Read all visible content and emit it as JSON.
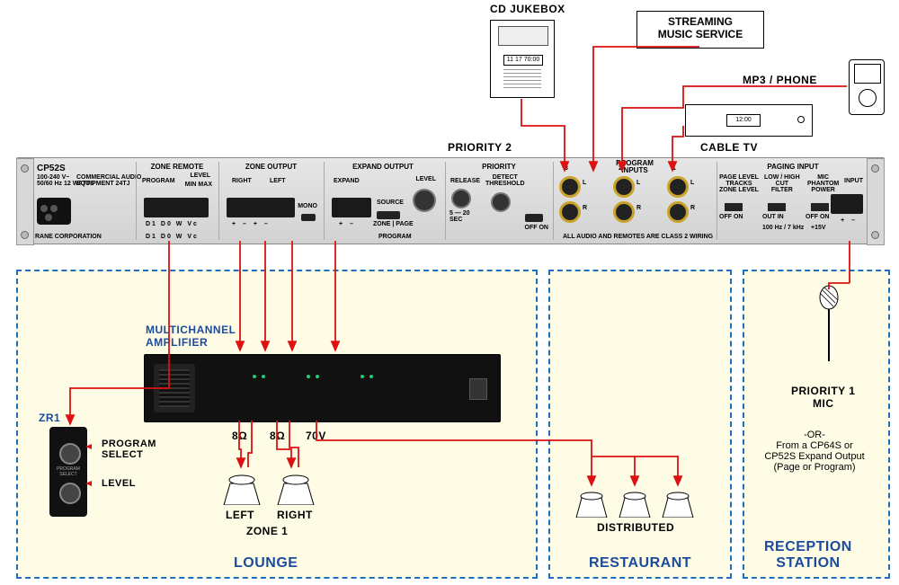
{
  "sources": {
    "cd_jukebox": "CD JUKEBOX",
    "streaming": "STREAMING\nMUSIC SERVICE",
    "mp3": "MP3 / PHONE",
    "cabletv": "CABLE TV",
    "jukebox_display": "11 17 70:00",
    "cabletv_time": "12:00"
  },
  "priorities": {
    "p1": "PRIORITY 1\nMIC",
    "p2": "PRIORITY 2"
  },
  "rack": {
    "model": "CP52S",
    "power_spec": "100-240 V~\n50/60 Hz 12 WATTS",
    "brand": "RANE CORPORATION",
    "ul": "COMMERCIAL AUDIO\nEQUIPMENT 24TJ",
    "sections": {
      "zone_remote": {
        "title": "ZONE REMOTE",
        "program": "PROGRAM",
        "level": "LEVEL",
        "pins": "D1  D0    W  Vc",
        "pins2": "MIN   MAX"
      },
      "zone_output": {
        "title": "ZONE OUTPUT",
        "right": "RIGHT",
        "left": "LEFT",
        "mono": "MONO",
        "pins": "+  –   +  –"
      },
      "expand_output": {
        "title": "EXPAND OUTPUT",
        "expand": "EXPAND",
        "source": "SOURCE",
        "switch": "ZONE | PAGE",
        "program": "PROGRAM",
        "level": "LEVEL",
        "pins": "+  –"
      },
      "priority": {
        "title": "PRIORITY",
        "release": "RELEASE",
        "release_scale": "5 — 20\nSEC",
        "detect": "DETECT\nTHRESHOLD",
        "offon": "OFF   ON"
      },
      "program_inputs": {
        "title": "PROGRAM\nINPUTS",
        "ch": [
          "3",
          "2",
          "1"
        ],
        "lr": [
          "L",
          "R"
        ]
      },
      "paging_input": {
        "title": "PAGING INPUT",
        "page_level": "PAGE LEVEL\nTRACKS\nZONE LEVEL",
        "filter": "LOW / HIGH\nCUT\nFILTER",
        "filter_vals": "100 Hz / 7 kHz",
        "phantom": "MIC\nPHANTOM\nPOWER",
        "phantom_val": "+15V",
        "input": "INPUT",
        "offon": "OFF       ON",
        "outin": "OUT       IN",
        "pins": "+  –"
      }
    },
    "class2": "ALL AUDIO AND REMOTES ARE CLASS 2 WIRING"
  },
  "rooms": {
    "lounge": {
      "title": "LOUNGE",
      "amp_title": "MULTICHANNEL\nAMPLIFIER",
      "spkr_l": "LEFT",
      "spkr_r": "RIGHT",
      "zone": "ZONE 1",
      "imp1": "8Ω",
      "imp2": "8Ω",
      "imp3": "70V"
    },
    "restaurant": {
      "title": "RESTAURANT",
      "dist": "DISTRIBUTED"
    },
    "reception": {
      "title": "RECEPTION\nSTATION",
      "alt": "-OR-\nFrom a CP64S or\nCP52S Expand Output\n(Page or Program)"
    }
  },
  "zr1": {
    "model": "ZR1",
    "program_select": "PROGRAM\nSELECT",
    "level": "LEVEL",
    "panel": "PROGRAM SELECT"
  }
}
